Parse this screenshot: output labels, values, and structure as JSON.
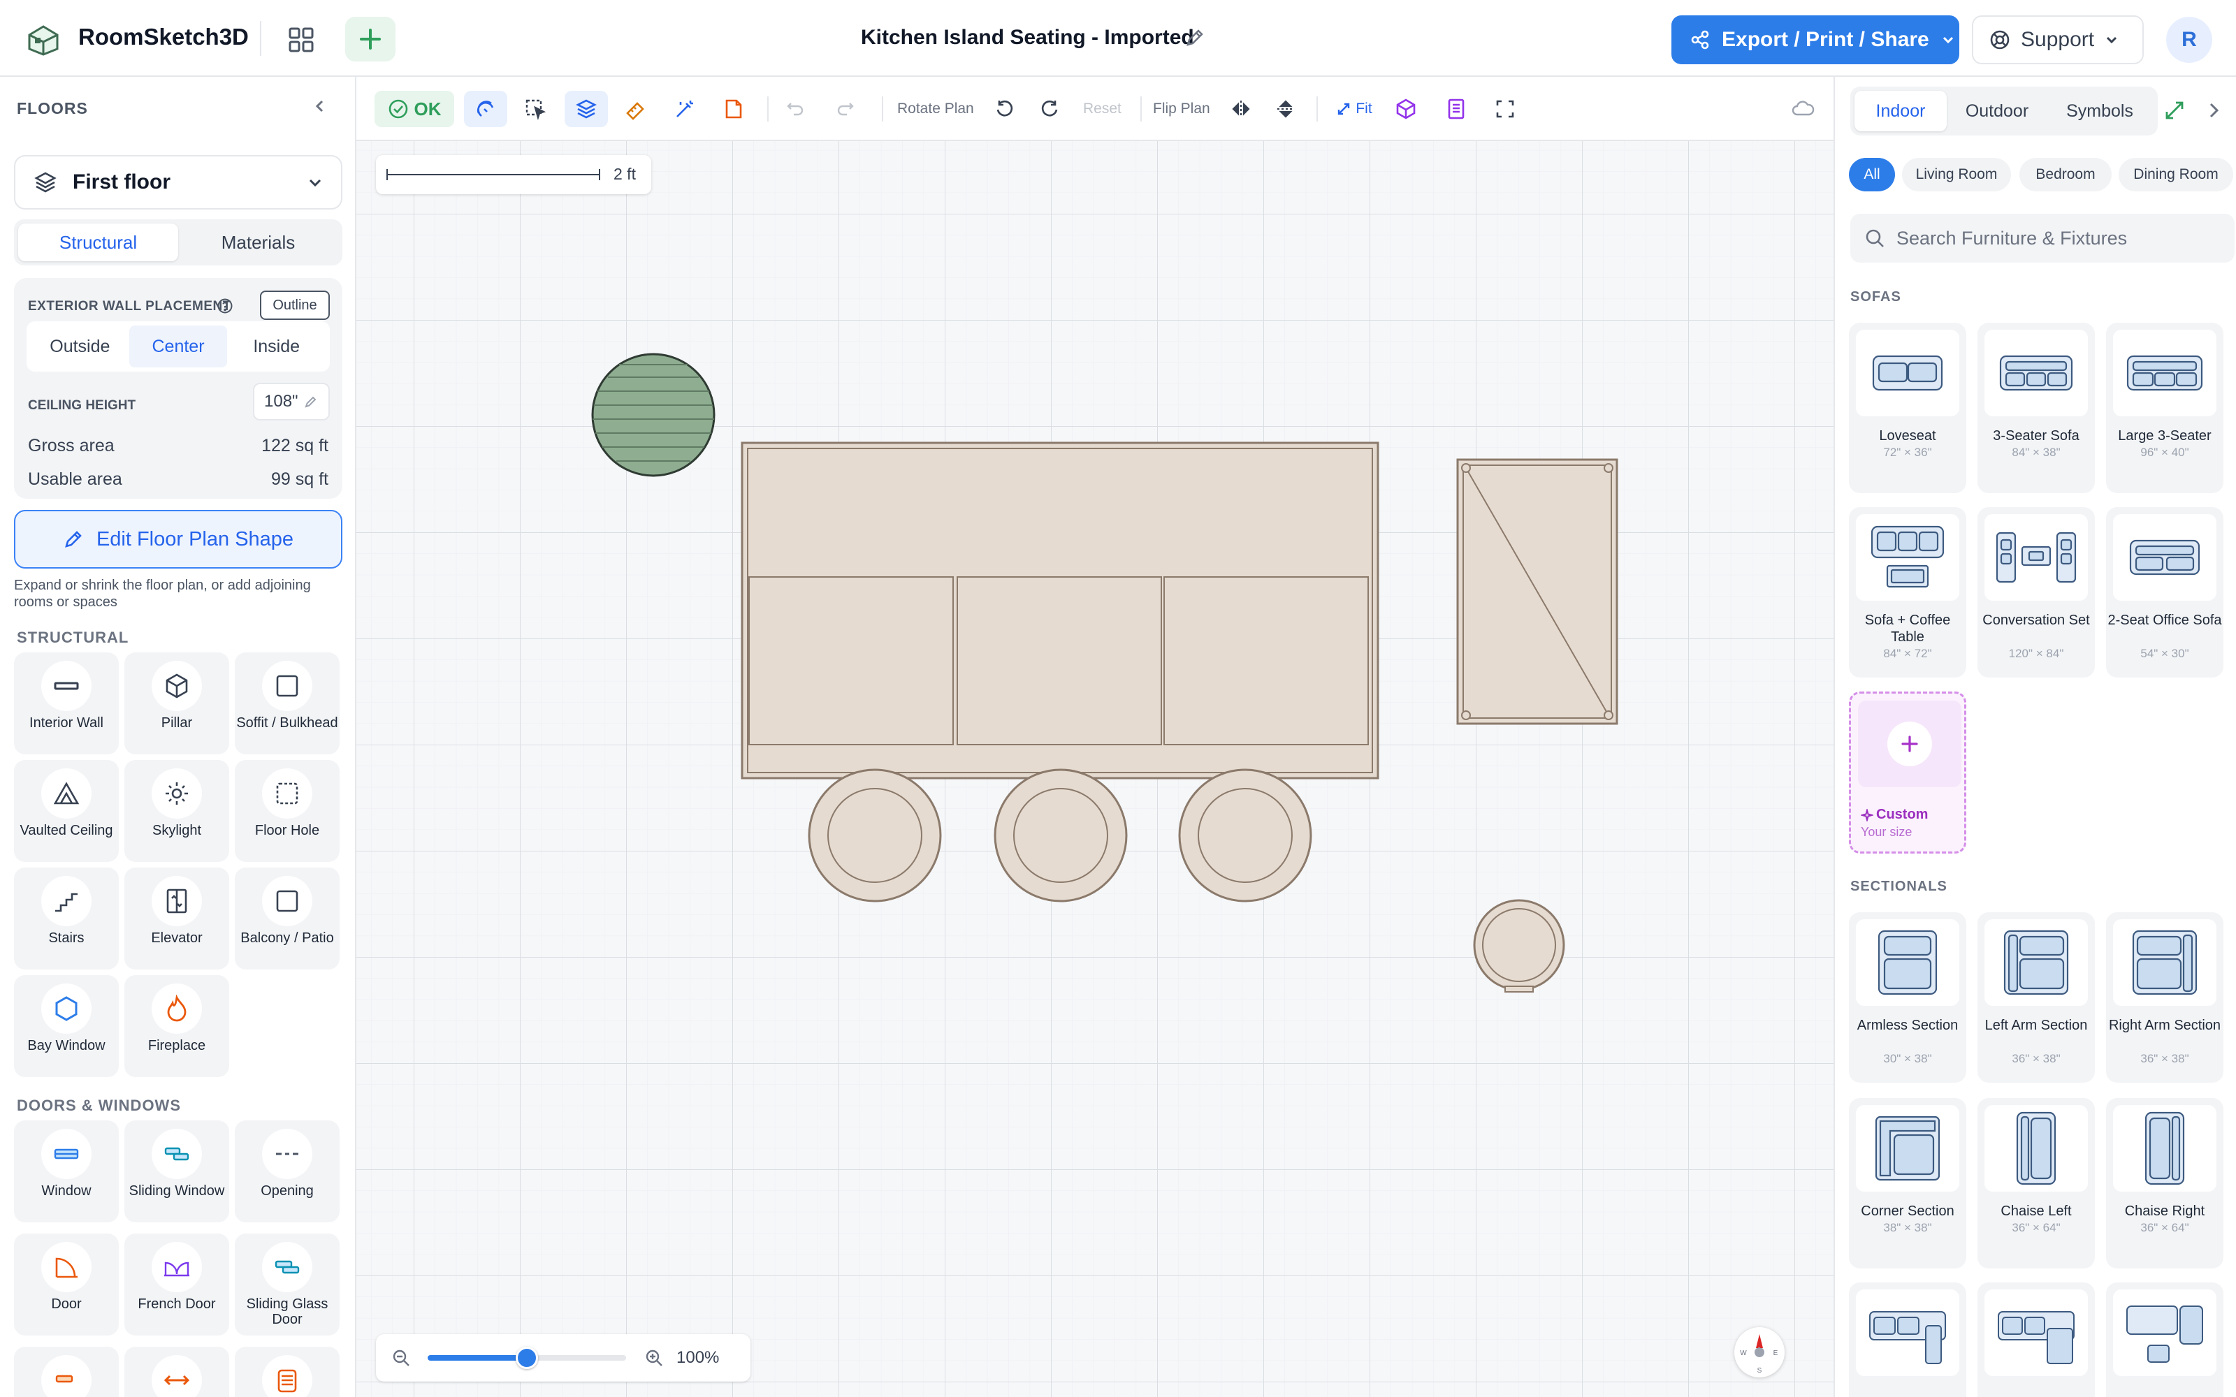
{
  "app": {
    "name": "RoomSketch3D",
    "document_title": "Kitchen Island Seating - Imported",
    "avatar_initial": "R"
  },
  "header": {
    "export_label": "Export / Print / Share",
    "support_label": "Support"
  },
  "left": {
    "floors_title": "FLOORS",
    "floor_select": "First floor",
    "tabs": [
      "Structural",
      "Materials"
    ],
    "wall_placement_label": "EXTERIOR WALL PLACEMENT",
    "outline_label": "Outline",
    "placement_options": [
      "Outside",
      "Center",
      "Inside"
    ],
    "ceiling_label": "CEILING HEIGHT",
    "ceiling_value": "108\"",
    "gross_label": "Gross area",
    "gross_value": "122 sq ft",
    "usable_label": "Usable area",
    "usable_value": "99 sq ft",
    "edit_shape_label": "Edit Floor Plan Shape",
    "help_text": "Expand or shrink the floor plan, or add adjoining rooms or spaces",
    "structural_title": "STRUCTURAL",
    "structural_items": [
      "Interior Wall",
      "Pillar",
      "Soffit / Bulkhead",
      "Vaulted Ceiling",
      "Skylight",
      "Floor Hole",
      "Stairs",
      "Elevator",
      "Balcony / Patio",
      "Bay Window",
      "Fireplace"
    ],
    "doors_title": "DOORS & WINDOWS",
    "door_items": [
      "Window",
      "Sliding Window",
      "Opening",
      "Door",
      "French Door",
      "Sliding Glass Door"
    ]
  },
  "toolbar": {
    "ok_label": "OK",
    "rotate_label": "Rotate Plan",
    "reset_label": "Reset",
    "flip_label": "Flip Plan",
    "fit_label": "Fit"
  },
  "canvas": {
    "scale_label": "2 ft",
    "zoom_label": "100%",
    "zoom_level": 0.5,
    "compass": [
      "N",
      "W",
      "E",
      "S"
    ]
  },
  "right": {
    "tabs": [
      "Indoor",
      "Outdoor",
      "Symbols"
    ],
    "chips": [
      "All",
      "Living Room",
      "Bedroom",
      "Dining Room"
    ],
    "search_placeholder": "Search Furniture & Fixtures",
    "sofas_title": "SOFAS",
    "sofas": [
      {
        "name": "Loveseat",
        "dims": "72\" × 36\""
      },
      {
        "name": "3-Seater Sofa",
        "dims": "84\" × 38\""
      },
      {
        "name": "Large 3-Seater",
        "dims": "96\" × 40\""
      },
      {
        "name": "Sofa + Coffee Table",
        "dims": "84\" × 72\""
      },
      {
        "name": "Conversation Set",
        "dims": "120\" × 84\""
      },
      {
        "name": "2-Seat Office Sofa",
        "dims": "54\" × 30\""
      }
    ],
    "custom_label": "Custom",
    "custom_sub": "Your size",
    "sectionals_title": "SECTIONALS",
    "sectionals": [
      {
        "name": "Armless Section",
        "dims": "30\" × 38\""
      },
      {
        "name": "Left Arm Section",
        "dims": "36\" × 38\""
      },
      {
        "name": "Right Arm Section",
        "dims": "36\" × 38\""
      },
      {
        "name": "Corner Section",
        "dims": "38\" × 38\""
      },
      {
        "name": "Chaise Left",
        "dims": "36\" × 64\""
      },
      {
        "name": "Chaise Right",
        "dims": "36\" × 64\""
      }
    ]
  },
  "colors": {
    "accent": "#2d7de9",
    "furniture_fill": "#e6dbd0",
    "furniture_stroke": "#8b7a6b",
    "plant_fill": "#8fae91"
  }
}
